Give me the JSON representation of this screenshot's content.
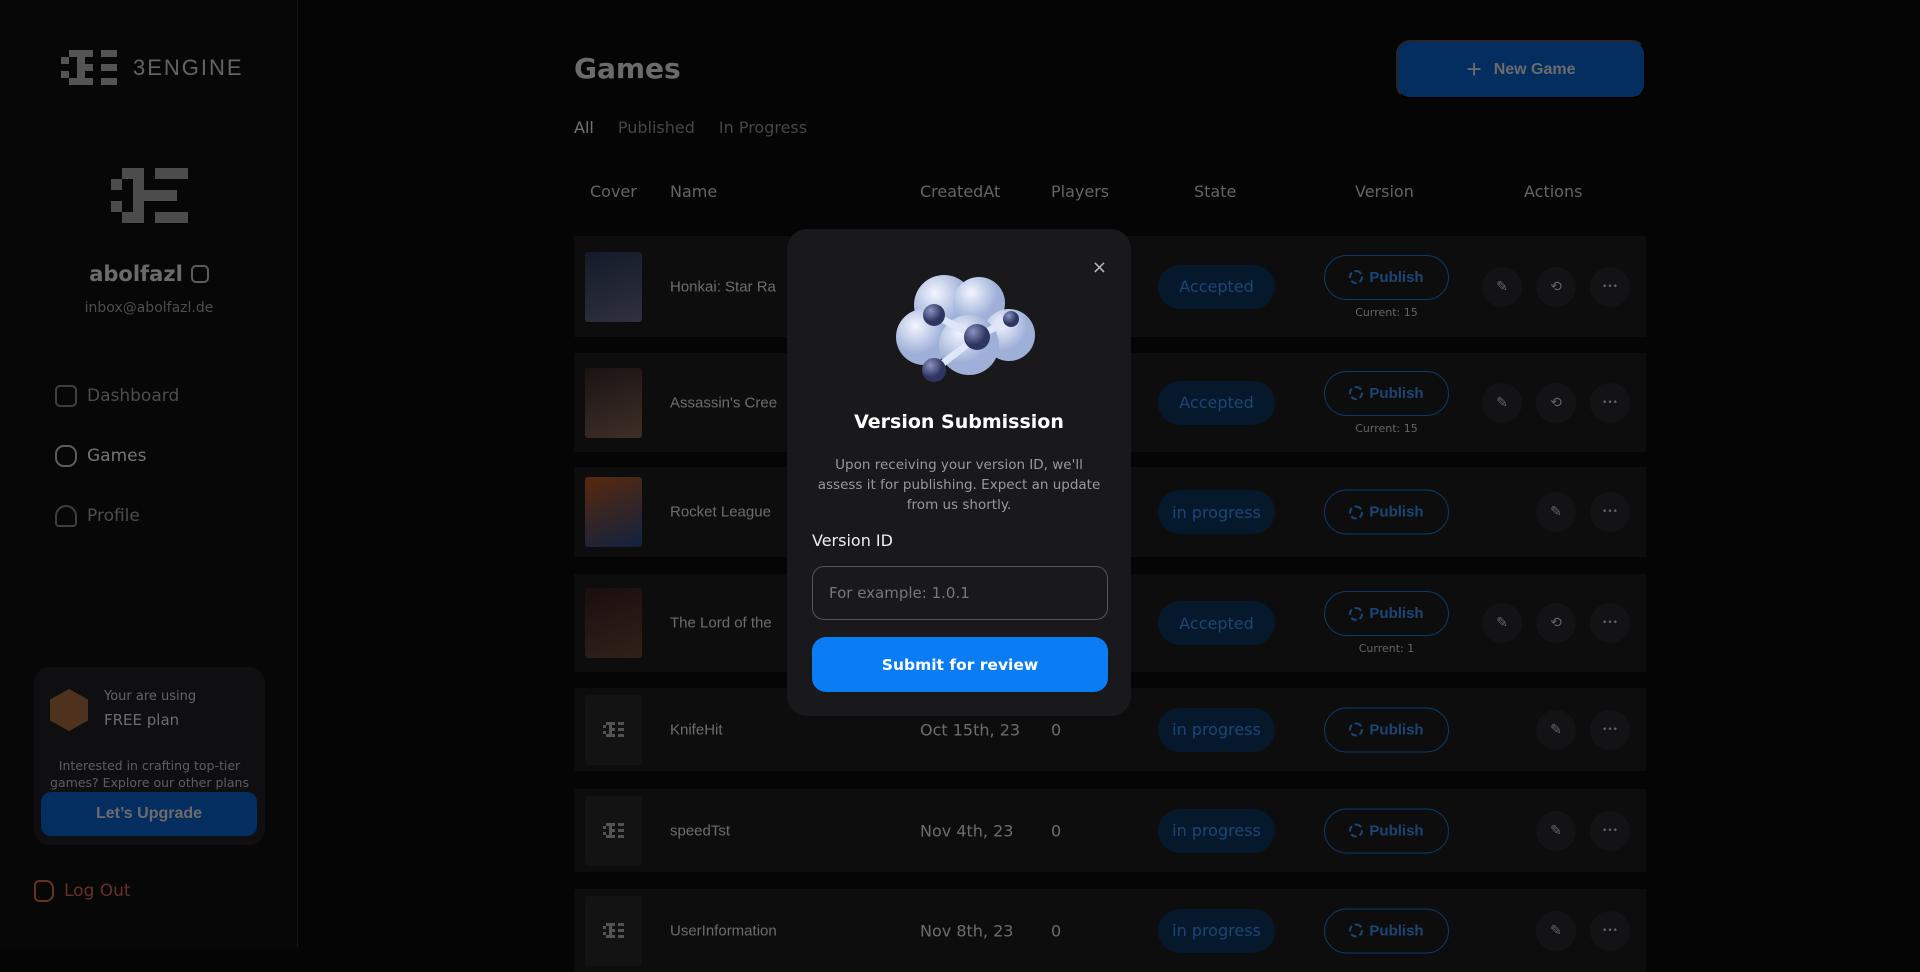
{
  "brand": {
    "name": "3ENGINE"
  },
  "user": {
    "name": "abolfazl",
    "email": "inbox@abolfazl.de"
  },
  "nav": [
    {
      "label": "Dashboard",
      "icon": "dashboard-icon"
    },
    {
      "label": "Games",
      "icon": "gamepad-icon",
      "active": true
    },
    {
      "label": "Profile",
      "icon": "user-icon"
    }
  ],
  "plan": {
    "using": "Your are using",
    "name": "FREE plan",
    "desc": "Interested in crafting top-tier games? Explore our other plans",
    "button": "Let’s Upgrade"
  },
  "logout": "Log Out",
  "page": {
    "title": "Games",
    "new_game": "New Game",
    "tabs": [
      "All",
      "Published",
      "In Progress"
    ]
  },
  "columns": [
    "Cover",
    "Name",
    "CreatedAt",
    "Players",
    "State",
    "Version",
    "Actions"
  ],
  "rows": [
    {
      "name": "Honkai: Star Ra",
      "created": "",
      "players": "",
      "state": "Accepted",
      "publish": "Publish",
      "current": "Current: 15",
      "cover": [
        "#2a3a5c",
        "#6a6f8a"
      ],
      "actions": [
        "edit",
        "share",
        "more"
      ]
    },
    {
      "name": "Assassin's Cree",
      "created": "",
      "players": "",
      "state": "Accepted",
      "publish": "Publish",
      "current": "Current: 15",
      "cover": [
        "#3a2a2a",
        "#8a6a5a"
      ],
      "actions": [
        "edit",
        "share",
        "more"
      ]
    },
    {
      "name": "Rocket League",
      "created": "",
      "players": "",
      "state": "in progress",
      "publish": "Publish",
      "current": "",
      "cover": [
        "#c05a20",
        "#2a4a8a"
      ],
      "actions": [
        "edit",
        "more"
      ]
    },
    {
      "name": "The Lord of the",
      "created": "",
      "players": "",
      "state": "Accepted",
      "publish": "Publish",
      "current": "Current: 1",
      "cover": [
        "#3a2020",
        "#6a4a3a"
      ],
      "actions": [
        "edit",
        "share",
        "more"
      ]
    },
    {
      "name": "KnifeHit",
      "created": "Oct 15th, 23",
      "players": "0",
      "state": "in progress",
      "publish": "Publish",
      "current": "",
      "cover": null,
      "actions": [
        "edit",
        "more"
      ]
    },
    {
      "name": "speedTst",
      "created": "Nov 4th, 23",
      "players": "0",
      "state": "in progress",
      "publish": "Publish",
      "current": "",
      "cover": null,
      "actions": [
        "edit",
        "more"
      ]
    },
    {
      "name": "UserInformation",
      "created": "Nov 8th, 23",
      "players": "0",
      "state": "in progress",
      "publish": "Publish",
      "current": "",
      "cover": null,
      "actions": [
        "edit",
        "more"
      ]
    }
  ],
  "modal": {
    "title": "Version Submission",
    "desc": "Upon receiving your version ID, we'll assess it for publishing. Expect an update from us shortly.",
    "label": "Version ID",
    "placeholder": "For example: 1.0.1",
    "value": "",
    "submit": "Submit for review",
    "close": "×"
  },
  "colors": {
    "accent": "#0a7df5",
    "state_text": "#2b88f0",
    "logout": "#c05a3a"
  }
}
